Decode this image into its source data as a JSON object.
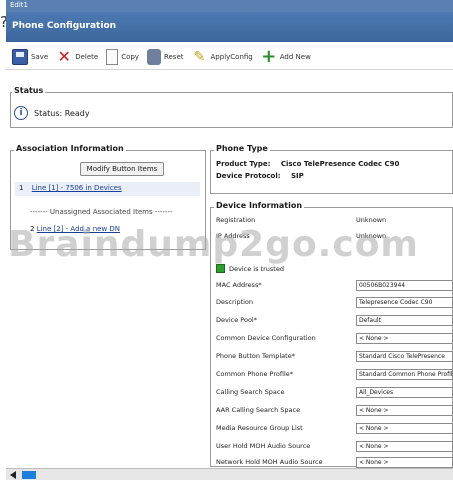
{
  "window": {
    "title": "Edit1",
    "question_mark": "?"
  },
  "header": {
    "title": "Phone Configuration"
  },
  "toolbar": {
    "save": "Save",
    "delete": "Delete",
    "copy": "Copy",
    "reset": "Reset",
    "apply_config": "ApplyConfig",
    "add_new": "Add New"
  },
  "status": {
    "title": "Status",
    "text": "Status: Ready"
  },
  "association": {
    "title": "Association Information",
    "modify_button": "Modify Button Items",
    "line1_num": "1",
    "line1": "Line [1] - 7506 in Devices",
    "unassigned": "------- Unassigned Associated Items -------",
    "line2_num": "2",
    "line2": "Line [2] - Add a new DN"
  },
  "phone_type": {
    "title": "Phone Type",
    "product_label": "Product Type:",
    "product_value": "Cisco TelePresence Codec C90",
    "protocol_label": "Device Protocol:",
    "protocol_value": "SIP"
  },
  "device_info": {
    "title": "Device Information",
    "registration_label": "Registration",
    "registration_value": "Unknown",
    "ip_label": "IP Address",
    "ip_value": "Unknown",
    "device_trusted": "Device is trusted",
    "mac_label": "MAC Address*",
    "mac_value": "00506B023944",
    "description_label": "Description",
    "description_value": "Telepresence Codec C90",
    "pool_label": "Device Pool*",
    "pool_value": "Default",
    "common_config_label": "Common Device Configuration",
    "common_config_value": "< None >",
    "button_template_label": "Phone Button Template*",
    "button_template_value": "Standard Cisco TelePresence",
    "common_profile_label": "Common Phone Profile*",
    "common_profile_value": "Standard Common Phone Profile",
    "css_label": "Calling Search Space",
    "css_value": "All_Devices",
    "aar_css_label": "AAR Calling Search Space",
    "aar_css_value": "< None >",
    "mrgl_label": "Media Resource Group List",
    "mrgl_value": "< None >",
    "user_moh_label": "User Hold MOH Audio Source",
    "user_moh_value": "< None >",
    "network_moh_label": "Network Hold MOH Audio Source",
    "network_moh_value": "< None >"
  },
  "watermark": "Braindump2go.com",
  "colors": {
    "header": "#4d79b2",
    "link": "#1a3f99",
    "scroll_thumb": "#1b7fe0",
    "check": "#2f9c2f"
  }
}
